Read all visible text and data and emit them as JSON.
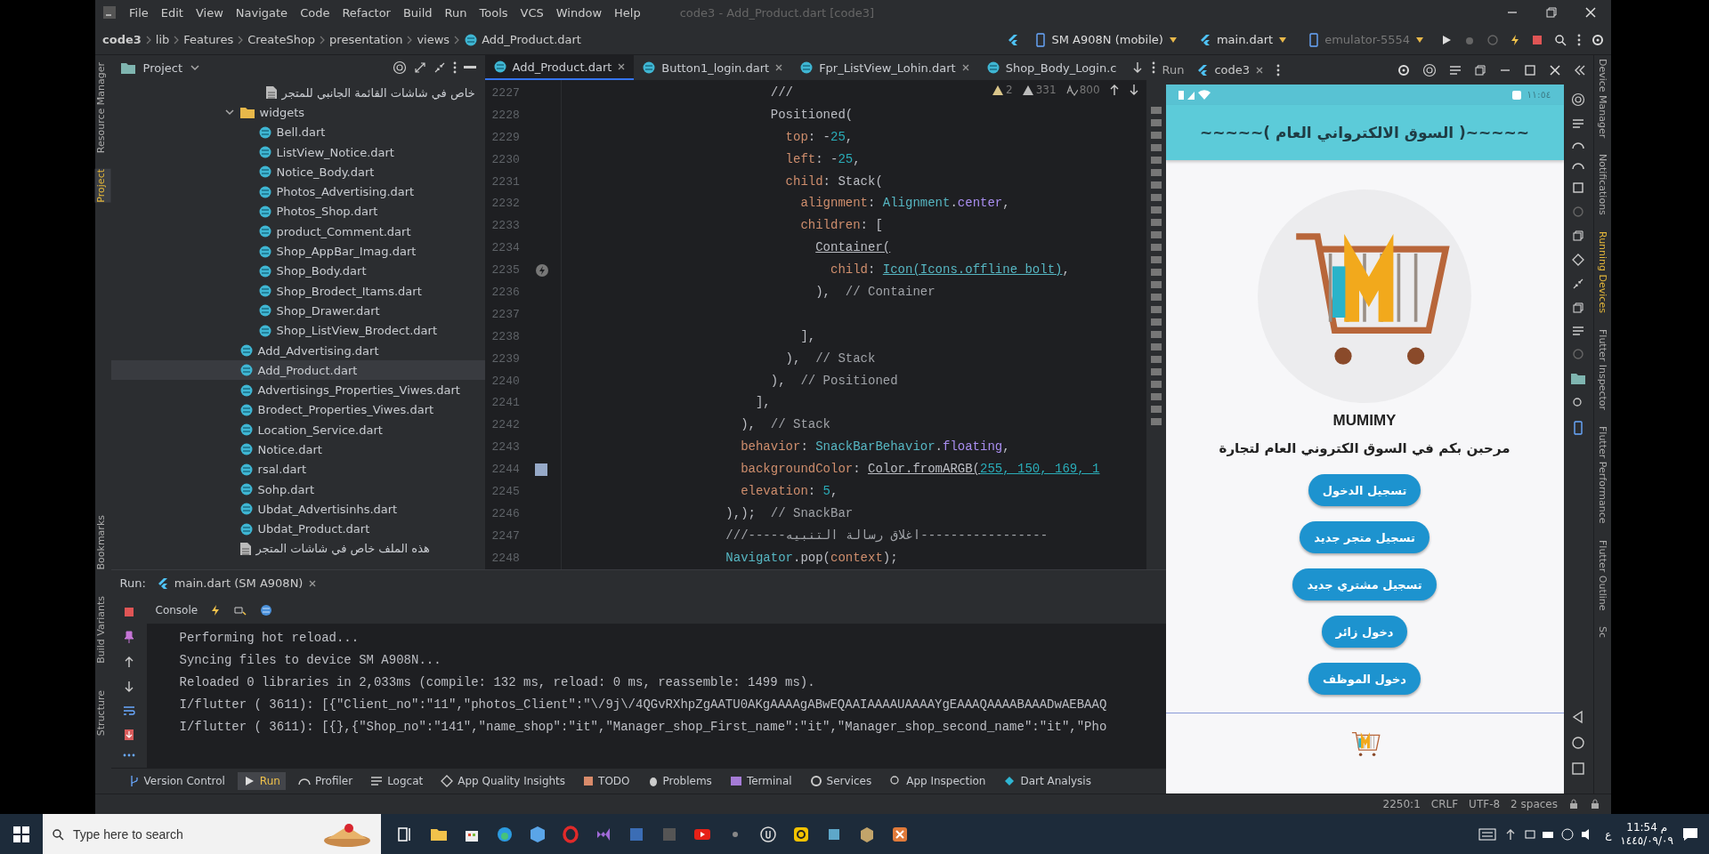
{
  "menubar": {
    "menus": [
      "File",
      "Edit",
      "View",
      "Navigate",
      "Code",
      "Refactor",
      "Build",
      "Run",
      "Tools",
      "VCS",
      "Window",
      "Help"
    ],
    "title": "code3 - Add_Product.dart [code3]"
  },
  "navbar": {
    "breadcrumbs": [
      "code3",
      "lib",
      "Features",
      "CreateShop",
      "presentation",
      "views",
      "Add_Product.dart"
    ],
    "device": "SM A908N (mobile)",
    "run_config": "main.dart",
    "emulator": "emulator-5554"
  },
  "left_strip": {
    "top": [
      {
        "label": "Resource Manager",
        "selected": false
      },
      {
        "label": "Project",
        "selected": true
      },
      {
        "label": "Bookmarks",
        "selected": false
      }
    ],
    "bottom": [
      {
        "label": "Build Variants",
        "selected": false
      },
      {
        "label": "Structure",
        "selected": false
      }
    ]
  },
  "project": {
    "title": "Project",
    "top_row": "خاص في شاشات القائمة الجانبي للمتجر",
    "tree": [
      {
        "kind": "folder",
        "label": "widgets",
        "selected": false,
        "expanded": true,
        "children": [
          {
            "kind": "dart",
            "label": "Bell.dart",
            "selected": false
          },
          {
            "kind": "dart",
            "label": "ListView_Notice.dart",
            "selected": false
          },
          {
            "kind": "dart",
            "label": "Notice_Body.dart",
            "selected": false
          },
          {
            "kind": "dart",
            "label": "Photos_Advertising.dart",
            "selected": false
          },
          {
            "kind": "dart",
            "label": "Photos_Shop.dart",
            "selected": false
          },
          {
            "kind": "dart",
            "label": "product_Comment.dart",
            "selected": false
          },
          {
            "kind": "dart",
            "label": "Shop_AppBar_Imag.dart",
            "selected": false
          },
          {
            "kind": "dart",
            "label": "Shop_Body.dart",
            "selected": false
          },
          {
            "kind": "dart",
            "label": "Shop_Brodect_Itams.dart",
            "selected": false
          },
          {
            "kind": "dart",
            "label": "Shop_Drawer.dart",
            "selected": false
          },
          {
            "kind": "dart",
            "label": "Shop_ListView_Brodect.dart",
            "selected": false
          }
        ]
      },
      {
        "kind": "dart",
        "label": "Add_Advertising.dart",
        "selected": false
      },
      {
        "kind": "dart",
        "label": "Add_Product.dart",
        "selected": true
      },
      {
        "kind": "dart",
        "label": "Advertisings_Properties_Viwes.dart",
        "selected": false
      },
      {
        "kind": "dart",
        "label": "Brodect_Properties_Viwes.dart",
        "selected": false
      },
      {
        "kind": "dart",
        "label": "Location_Service.dart",
        "selected": false
      },
      {
        "kind": "dart",
        "label": "Notice.dart",
        "selected": false
      },
      {
        "kind": "dart",
        "label": "rsal.dart",
        "selected": false
      },
      {
        "kind": "dart",
        "label": "Sohp.dart",
        "selected": false
      },
      {
        "kind": "dart",
        "label": "Ubdat_Advertisinhs.dart",
        "selected": false
      },
      {
        "kind": "dart",
        "label": "Ubdat_Product.dart",
        "selected": false
      },
      {
        "kind": "doc",
        "label": "هذه الملف خاص في شاشات المتجر",
        "selected": false
      }
    ]
  },
  "editor": {
    "tabs": [
      {
        "label": "Add_Product.dart",
        "selected": true,
        "closable": true
      },
      {
        "label": "Button1_login.dart",
        "selected": false,
        "closable": true
      },
      {
        "label": "Fpr_ListView_Lohin.dart",
        "selected": false,
        "closable": true
      },
      {
        "label": "Shop_Body_Login.c",
        "selected": false,
        "closable": false
      }
    ],
    "inspections": [
      {
        "kind": "weak",
        "count": "2"
      },
      {
        "kind": "warning",
        "count": "331"
      },
      {
        "kind": "typo",
        "count": "800"
      }
    ],
    "lines": [
      {
        "n": "2227",
        "code": [
          {
            "text": "                            ///",
            "kind": "plain"
          }
        ]
      },
      {
        "n": "2228",
        "code": [
          {
            "text": "                            Positioned(",
            "kind": "plain"
          }
        ]
      },
      {
        "n": "2229",
        "code": [
          {
            "text": "                              top",
            "kind": "arg"
          },
          {
            "text": ": -",
            "kind": "plain"
          },
          {
            "text": "25",
            "kind": "num"
          },
          {
            "text": ",",
            "kind": "plain"
          }
        ]
      },
      {
        "n": "2230",
        "code": [
          {
            "text": "                              left",
            "kind": "arg"
          },
          {
            "text": ": -",
            "kind": "plain"
          },
          {
            "text": "25",
            "kind": "num"
          },
          {
            "text": ",",
            "kind": "plain"
          }
        ]
      },
      {
        "n": "2231",
        "code": [
          {
            "text": "                              child",
            "kind": "arg"
          },
          {
            "text": ": Stack(",
            "kind": "plain"
          }
        ]
      },
      {
        "n": "2232",
        "code": [
          {
            "text": "                                alignment",
            "kind": "arg"
          },
          {
            "text": ": ",
            "kind": "plain"
          },
          {
            "text": "Alignment",
            "kind": "type"
          },
          {
            "text": ".",
            "kind": "plain"
          },
          {
            "text": "center",
            "kind": "member"
          },
          {
            "text": ",",
            "kind": "plain"
          }
        ]
      },
      {
        "n": "2233",
        "code": [
          {
            "text": "                                children",
            "kind": "arg"
          },
          {
            "text": ": [",
            "kind": "plain"
          }
        ]
      },
      {
        "n": "2234",
        "code": [
          {
            "text": "                                  Container(",
            "kind": "ctor"
          }
        ]
      },
      {
        "n": "2235",
        "kind": "bolt",
        "code": [
          {
            "text": "                                    child",
            "kind": "arg"
          },
          {
            "text": ": ",
            "kind": "plain"
          },
          {
            "text": "Icon(Icons.offline_bolt)",
            "kind": "link"
          },
          {
            "text": ",",
            "kind": "plain"
          }
        ]
      },
      {
        "n": "2236",
        "code": [
          {
            "text": "                                  ),  ",
            "kind": "plain"
          },
          {
            "text": "// Container",
            "kind": "comment"
          }
        ]
      },
      {
        "n": "2237",
        "kind": "blank"
      },
      {
        "n": "2238",
        "code": [
          {
            "text": "                                ],",
            "kind": "plain"
          }
        ]
      },
      {
        "n": "2239",
        "code": [
          {
            "text": "                              ),  ",
            "kind": "plain"
          },
          {
            "text": "// Stack",
            "kind": "comment"
          }
        ]
      },
      {
        "n": "2240",
        "code": [
          {
            "text": "                            ),  ",
            "kind": "plain"
          },
          {
            "text": "// Positioned",
            "kind": "comment"
          }
        ]
      },
      {
        "n": "2241",
        "code": [
          {
            "text": "                          ],",
            "kind": "plain"
          }
        ]
      },
      {
        "n": "2242",
        "code": [
          {
            "text": "                        ),  ",
            "kind": "plain"
          },
          {
            "text": "// Stack",
            "kind": "comment"
          }
        ]
      },
      {
        "n": "2243",
        "code": [
          {
            "text": "                        behavior",
            "kind": "arg"
          },
          {
            "text": ": ",
            "kind": "plain"
          },
          {
            "text": "SnackBarBehavior",
            "kind": "type"
          },
          {
            "text": ".",
            "kind": "plain"
          },
          {
            "text": "floating",
            "kind": "member"
          },
          {
            "text": ",",
            "kind": "plain"
          }
        ]
      },
      {
        "n": "2244",
        "kind": "swatch",
        "code": [
          {
            "text": "                        backgroundColor",
            "kind": "arg"
          },
          {
            "text": ": ",
            "kind": "plain"
          },
          {
            "text": "Color.fromARGB(",
            "kind": "ctor"
          },
          {
            "text": "255, 150, 169, 1",
            "kind": "numlink"
          }
        ]
      },
      {
        "n": "2245",
        "code": [
          {
            "text": "                        elevation",
            "kind": "arg"
          },
          {
            "text": ": ",
            "kind": "plain"
          },
          {
            "text": "5",
            "kind": "num"
          },
          {
            "text": ",",
            "kind": "plain"
          }
        ]
      },
      {
        "n": "2246",
        "code": [
          {
            "text": "                      ),);  ",
            "kind": "plain"
          },
          {
            "text": "// SnackBar",
            "kind": "comment"
          }
        ]
      },
      {
        "n": "2247",
        "code": [
          {
            "text": "                      ///-----اغلاق رسالة التنبيه-----------------",
            "kind": "comment"
          }
        ]
      },
      {
        "n": "2248",
        "code": [
          {
            "text": "                      Navigator",
            "kind": "type"
          },
          {
            "text": ".pop(",
            "kind": "plain"
          },
          {
            "text": "context",
            "kind": "arg"
          },
          {
            "text": ");",
            "kind": "plain"
          }
        ]
      }
    ]
  },
  "run_panel": {
    "label": "Run:",
    "tab": "main.dart (SM A908N)",
    "console": "Console",
    "output": [
      "Performing hot reload...",
      "Syncing files to device SM A908N...",
      "Reloaded 0 libraries in 2,033ms (compile: 132 ms, reload: 0 ms, reassemble: 1499 ms).",
      "I/flutter ( 3611): [{\"Client_no\":\"11\",\"photos_Client\":\"\\/9j\\/4QGvRXhpZgAATU0AKgAAAAgABwEQAAIAAAAUAAAAYgEAAAQAAAABAAADwAEBAAQ",
      "I/flutter ( 3611): [{},{\"Shop_no\":\"141\",\"name_shop\":\"it\",\"Manager_shop_First_name\":\"it\",\"Manager_shop_second_name\":\"it\",\"Pho"
    ]
  },
  "bottom_tabs": [
    {
      "label": "Version Control",
      "selected": false
    },
    {
      "label": "Run",
      "selected": true
    },
    {
      "label": "Profiler",
      "selected": false
    },
    {
      "label": "Logcat",
      "selected": false
    },
    {
      "label": "App Quality Insights",
      "selected": false
    },
    {
      "label": "TODO",
      "selected": false
    },
    {
      "label": "Problems",
      "selected": false
    },
    {
      "label": "Terminal",
      "selected": false
    },
    {
      "label": "Services",
      "selected": false
    },
    {
      "label": "App Inspection",
      "selected": false
    },
    {
      "label": "Dart Analysis",
      "selected": false
    }
  ],
  "emulator": {
    "header_label": "Run",
    "tab": "code3",
    "status_time": "١١:٥٤",
    "app": {
      "title": "~~~~~( السوق الالكترواني العام )~~~~~",
      "brand": "MUMIMY",
      "welcome": "مرحبن بكم في السوق الكتروني العام لتجارة",
      "buttons": [
        "تسجيل الدخول",
        "تسجيل متجر جديد",
        "تسجيل مشتري جديد",
        "دخول زائر",
        "دخول الموظف"
      ]
    }
  },
  "right_strip": [
    {
      "label": "Device Manager",
      "selected": false
    },
    {
      "label": "Notifications",
      "selected": false
    },
    {
      "label": "Running Devices",
      "selected": true
    },
    {
      "label": "Flutter Inspector",
      "selected": false
    },
    {
      "label": "Flutter Performance",
      "selected": false
    },
    {
      "label": "Flutter Outline",
      "selected": false
    },
    {
      "label": "Sc",
      "selected": false
    }
  ],
  "status_bar": [
    "2250:1",
    "CRLF",
    "UTF-8",
    "2 spaces"
  ],
  "taskbar": {
    "search": "Type here to search",
    "lang": "ع",
    "time": "11:54 م",
    "date": "١٤٤٥/٠٩/٠٩"
  }
}
